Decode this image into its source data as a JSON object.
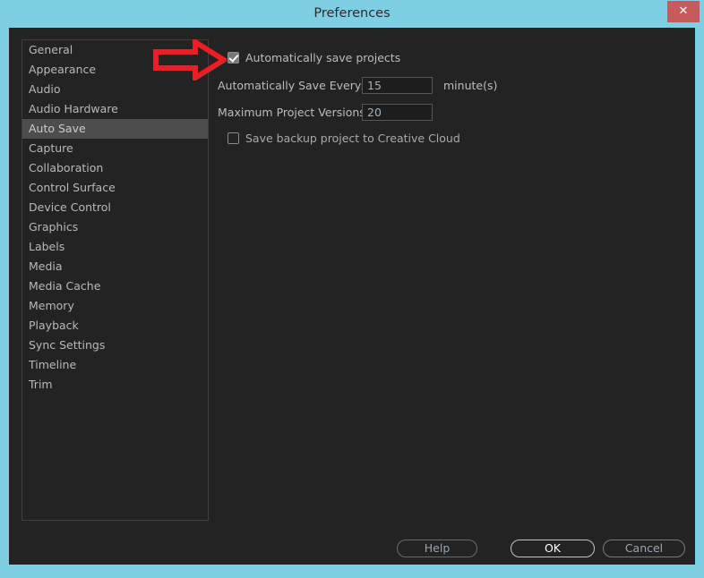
{
  "window": {
    "title": "Preferences",
    "close_label": "✕",
    "frame_color": "#7fcfe4",
    "body_color": "#232323",
    "close_color": "#c75b5b"
  },
  "sidebar": {
    "selected": "Auto Save",
    "items": [
      {
        "label": "General"
      },
      {
        "label": "Appearance"
      },
      {
        "label": "Audio"
      },
      {
        "label": "Audio Hardware"
      },
      {
        "label": "Auto Save"
      },
      {
        "label": "Capture"
      },
      {
        "label": "Collaboration"
      },
      {
        "label": "Control Surface"
      },
      {
        "label": "Device Control"
      },
      {
        "label": "Graphics"
      },
      {
        "label": "Labels"
      },
      {
        "label": "Media"
      },
      {
        "label": "Media Cache"
      },
      {
        "label": "Memory"
      },
      {
        "label": "Playback"
      },
      {
        "label": "Sync Settings"
      },
      {
        "label": "Timeline"
      },
      {
        "label": "Trim"
      }
    ]
  },
  "panel": {
    "autosave_checkbox": {
      "label": "Automatically save projects",
      "checked": true
    },
    "save_every": {
      "label": "Automatically Save Every:",
      "value": "15",
      "unit": "minute(s)"
    },
    "max_versions": {
      "label": "Maximum Project Versions:",
      "value": "20"
    },
    "backup_checkbox": {
      "label": "Save backup project to Creative Cloud",
      "checked": false
    }
  },
  "footer": {
    "help_label": "Help",
    "ok_label": "OK",
    "cancel_label": "Cancel"
  },
  "annotation": {
    "type": "arrow-right",
    "color": "#ee1c24",
    "points_at": "autosave-checkbox"
  }
}
